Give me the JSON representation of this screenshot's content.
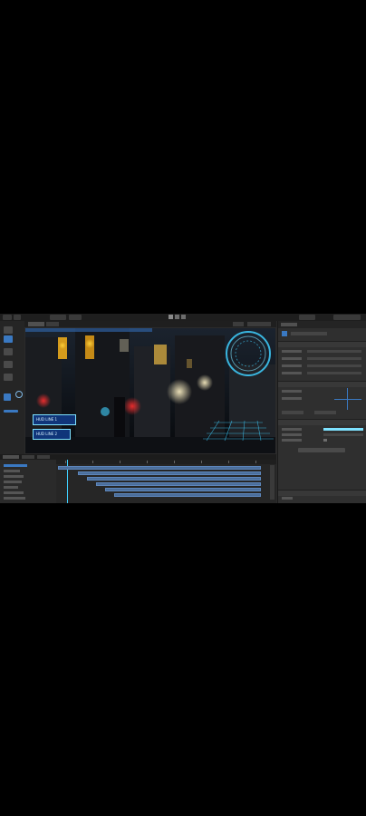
{
  "viewport": {
    "hud_lines": [
      "HUD LINE 1",
      "HUD LINE 2"
    ]
  },
  "colors": {
    "editor_bg": "#2b2b2b",
    "accent": "#3a79c2",
    "hud_cyan": "#3fd0ff",
    "timeline_track": "#4b6e9b"
  },
  "icons": {
    "play": "play-icon",
    "pause": "pause-icon",
    "step": "step-icon"
  }
}
